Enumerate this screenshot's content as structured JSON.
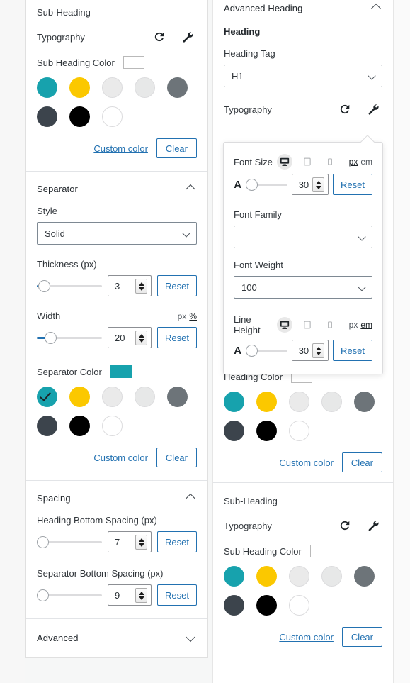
{
  "palette": {
    "colors": [
      {
        "name": "teal",
        "hex": "#17A2AD",
        "bordered": false
      },
      {
        "name": "gold",
        "hex": "#FBC800",
        "bordered": false
      },
      {
        "name": "light-gray-1",
        "hex": "#EAEAEA",
        "bordered": true
      },
      {
        "name": "light-gray-2",
        "hex": "#E7E8E8",
        "bordered": true
      },
      {
        "name": "medium-gray",
        "hex": "#6D7479",
        "bordered": false
      },
      {
        "name": "dark-slate",
        "hex": "#3C444C",
        "bordered": false
      },
      {
        "name": "black",
        "hex": "#000000",
        "bordered": false
      },
      {
        "name": "white",
        "hex": "#FFFFFF",
        "bordered": true
      }
    ],
    "custom_color_label": "Custom color",
    "clear_label": "Clear"
  },
  "left_panel": {
    "sub_heading": {
      "title": "Sub-Heading",
      "typography_label": "Typography",
      "reset_icon": "reset-icon",
      "settings_icon": "wrench-icon",
      "color_label": "Sub Heading Color",
      "color_preview": "#FFFFFF",
      "selected_index": null
    },
    "separator": {
      "title": "Separator",
      "collapse_state": "expanded",
      "style_label": "Style",
      "style_value": "Solid",
      "thickness_label": "Thickness (px)",
      "thickness_value": "3",
      "thickness_percent": 5,
      "width_label": "Width",
      "width_value": "20",
      "width_percent": 10,
      "width_units": [
        "px",
        "%"
      ],
      "width_unit_active": "%",
      "reset_label": "Reset",
      "color_label": "Separator Color",
      "color_preview": "#17A2AD",
      "selected_index": 0
    },
    "spacing": {
      "title": "Spacing",
      "collapse_state": "expanded",
      "heading_bottom_label": "Heading Bottom Spacing (px)",
      "heading_bottom_value": "7",
      "heading_bottom_percent": 0,
      "separator_bottom_label": "Separator Bottom Spacing (px)",
      "separator_bottom_value": "9",
      "separator_bottom_percent": 0,
      "reset_label": "Reset"
    },
    "advanced": {
      "title": "Advanced",
      "collapse_state": "collapsed"
    }
  },
  "right_panel": {
    "advanced_heading": {
      "title": "Advanced Heading",
      "collapse_state": "expanded"
    },
    "heading": {
      "group_label": "Heading",
      "tag_label": "Heading Tag",
      "tag_value": "H1",
      "typography_label": "Typography",
      "reset_icon": "reset-icon",
      "settings_icon": "wrench-icon",
      "color_label": "Heading Color",
      "color_preview": "#FFFFFF",
      "selected_index": null
    },
    "sub_heading": {
      "title": "Sub-Heading",
      "typography_label": "Typography",
      "color_label": "Sub Heading Color",
      "color_preview": "#FFFFFF",
      "selected_index": null
    }
  },
  "typography_popover": {
    "font_size": {
      "label": "Font Size",
      "value": "30",
      "slider_percent": 8,
      "units": [
        "px",
        "em"
      ],
      "unit_active": "px",
      "devices": [
        "desktop",
        "tablet",
        "mobile"
      ],
      "device_active": "desktop",
      "reset_label": "Reset",
      "size_glyph": "A"
    },
    "font_family": {
      "label": "Font Family",
      "value": ""
    },
    "font_weight": {
      "label": "Font Weight",
      "value": "100"
    },
    "line_height": {
      "label": "Line Height",
      "value": "30",
      "slider_percent": 8,
      "units": [
        "px",
        "em"
      ],
      "unit_active": "em",
      "devices": [
        "desktop",
        "tablet",
        "mobile"
      ],
      "device_active": "desktop",
      "reset_label": "Reset",
      "size_glyph": "A"
    }
  },
  "theme": {
    "accent_blue": "#2271b1",
    "text_dark": "#1d2327",
    "border_gray": "#8c8f94"
  }
}
